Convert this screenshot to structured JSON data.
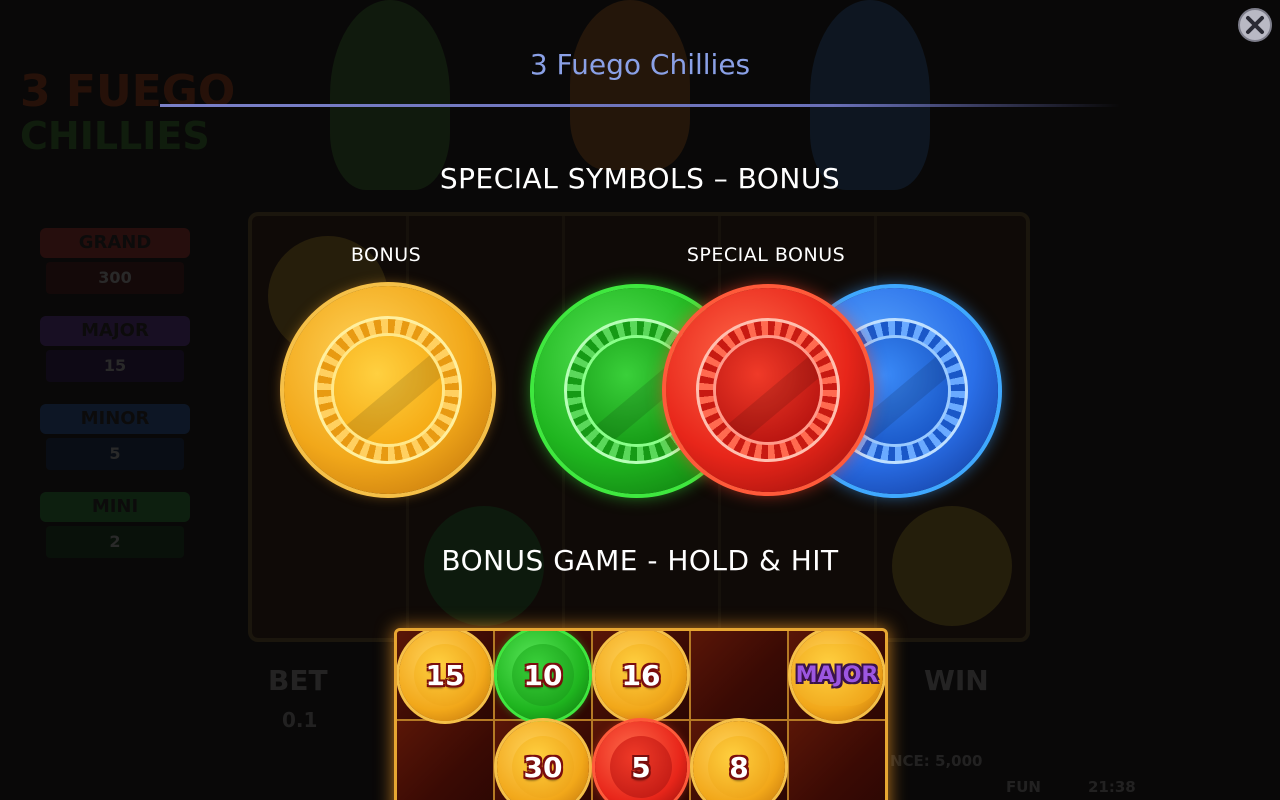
{
  "dialog": {
    "title": "3 Fuego Chillies",
    "close_icon": "close-icon"
  },
  "section_bonus": {
    "heading": "SPECIAL SYMBOLS – BONUS",
    "bonus_label": "BONUS",
    "special_bonus_label": "SPECIAL BONUS",
    "coins": [
      {
        "name": "gold-bonus-coin",
        "color": "#f2a81a"
      },
      {
        "name": "green-special-coin",
        "color": "#1fb51f"
      },
      {
        "name": "red-special-coin",
        "color": "#e8261a"
      },
      {
        "name": "blue-special-coin",
        "color": "#2a6fe8"
      }
    ]
  },
  "section_hold_hit": {
    "heading": "BONUS GAME - HOLD & HIT",
    "cells": [
      {
        "row": 0,
        "col": 0,
        "coin": "gold",
        "value": "15"
      },
      {
        "row": 0,
        "col": 1,
        "coin": "green",
        "value": "10"
      },
      {
        "row": 0,
        "col": 2,
        "coin": "gold",
        "value": "16"
      },
      {
        "row": 0,
        "col": 3,
        "coin": "",
        "value": ""
      },
      {
        "row": 0,
        "col": 4,
        "coin": "gold",
        "value": "MAJOR"
      },
      {
        "row": 1,
        "col": 0,
        "coin": "",
        "value": ""
      },
      {
        "row": 1,
        "col": 1,
        "coin": "gold",
        "value": "30"
      },
      {
        "row": 1,
        "col": 2,
        "coin": "red",
        "value": "5"
      },
      {
        "row": 1,
        "col": 3,
        "coin": "gold",
        "value": "8"
      },
      {
        "row": 1,
        "col": 4,
        "coin": "",
        "value": ""
      }
    ]
  },
  "background_game": {
    "logo_line1": "3 FUEGO",
    "logo_line2": "CHILLIES",
    "jackpots": [
      {
        "name": "GRAND",
        "value": "300",
        "color": "#d8342a"
      },
      {
        "name": "MAJOR",
        "value": "15",
        "color": "#7a3ac8"
      },
      {
        "name": "MINOR",
        "value": "5",
        "color": "#2a6fd8"
      },
      {
        "name": "MINI",
        "value": "2",
        "color": "#2aa83a"
      }
    ],
    "bet_label": "BET",
    "bet_value": "0.1",
    "win_label": "WIN",
    "balance_text": "NCE: 5,000",
    "fun_label": "FUN",
    "clock": "21:38"
  },
  "colors": {
    "title": "#8aa0e6",
    "board_border": "#e7a632"
  }
}
